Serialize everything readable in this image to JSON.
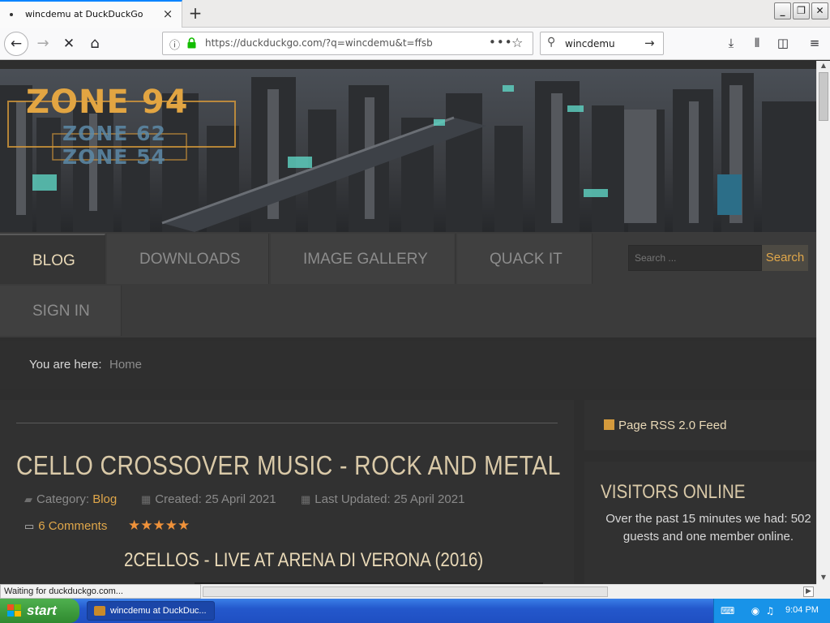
{
  "browser": {
    "tab_title": "wincdemu at DuckDuckGo",
    "new_tab": "+",
    "url": "https://duckduckgo.com/?q=wincdemu&t=ffsb",
    "search_text": "wincdemu",
    "status_text": "Waiting for duckduckgo.com..."
  },
  "site": {
    "logo": {
      "line1": "ZONE 94",
      "line2": "ZONE 62",
      "line3": "ZONE 54"
    },
    "nav": {
      "items": [
        {
          "label": "BLOG",
          "active": true
        },
        {
          "label": "DOWNLOADS"
        },
        {
          "label": "IMAGE GALLERY"
        },
        {
          "label": "QUACK IT"
        },
        {
          "label": "SIGN IN"
        }
      ],
      "search_placeholder": "Search ...",
      "search_button": "Search"
    },
    "breadcrumb": {
      "label": "You are here:",
      "current": "Home"
    },
    "article": {
      "title": "CELLO CROSSOVER MUSIC - ROCK AND METAL",
      "category_label": "Category:",
      "category": "Blog",
      "created": "Created: 25 April 2021",
      "updated": "Last Updated: 25 April 2021",
      "comments": "6 Comments",
      "rating_stars": "★★★★★",
      "subheading": "2CELLOS - LIVE AT ARENA DI VERONA (2016)"
    },
    "sidebar": {
      "rss": "Page RSS 2.0 Feed",
      "visitors_title": "VISITORS ONLINE",
      "visitors_text": "Over the past 15 minutes we had: 502 guests and one member online."
    }
  },
  "taskbar": {
    "start": "start",
    "task": "wincdemu at DuckDuc...",
    "clock": "9:04 PM"
  },
  "colors": {
    "accent": "#e0a74a",
    "nav_active": "#e9d9b7",
    "background": "#2e2e2e"
  }
}
